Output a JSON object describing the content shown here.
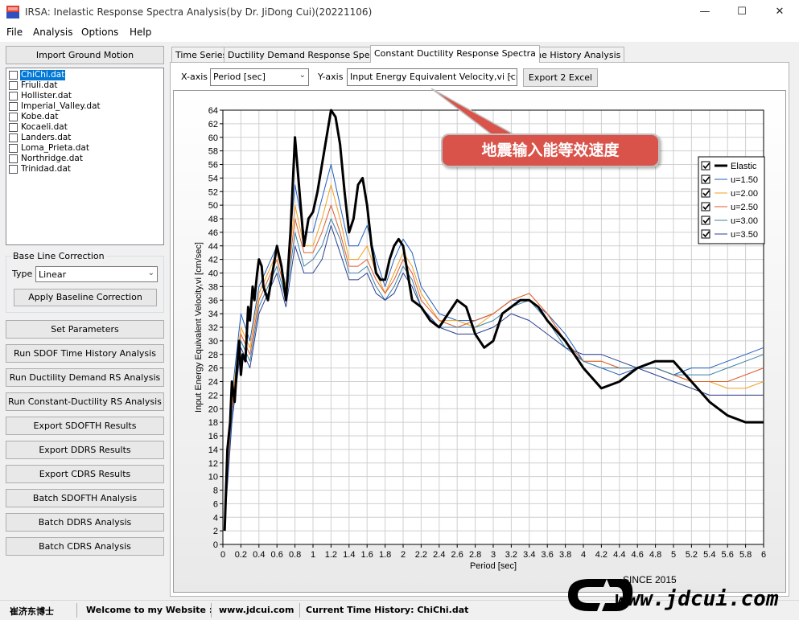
{
  "window": {
    "title": "IRSA: Inelastic Response Spectra Analysis(by Dr. JiDong Cui)(20221106)",
    "min_symbol": "—",
    "max_symbol": "☐",
    "close_symbol": "✕"
  },
  "menu": [
    "File",
    "Analysis",
    "Options",
    "Help"
  ],
  "left_panel": {
    "import_button": "Import Ground Motion",
    "files": [
      {
        "name": "ChiChi.dat",
        "selected": true
      },
      {
        "name": "Friuli.dat",
        "selected": false
      },
      {
        "name": "Hollister.dat",
        "selected": false
      },
      {
        "name": "Imperial_Valley.dat",
        "selected": false
      },
      {
        "name": "Kobe.dat",
        "selected": false
      },
      {
        "name": "Kocaeli.dat",
        "selected": false
      },
      {
        "name": "Landers.dat",
        "selected": false
      },
      {
        "name": "Loma_Prieta.dat",
        "selected": false
      },
      {
        "name": "Northridge.dat",
        "selected": false
      },
      {
        "name": "Trinidad.dat",
        "selected": false
      }
    ],
    "baseline": {
      "group_title": "Base Line Correction",
      "type_label": "Type",
      "type_value": "Linear",
      "apply_button": "Apply Baseline Correction"
    },
    "action_buttons": [
      "Set Parameters",
      "Run SDOF Time History Analysis",
      "Run Ductility Demand RS Analysis",
      "Run Constant-Ductility RS Analysis",
      "Export SDOFTH Results",
      "Export DDRS Results",
      "Export CDRS Results",
      "Batch SDOFTH Analysis",
      "Batch DDRS Analysis",
      "Batch CDRS Analysis"
    ]
  },
  "tabs": [
    {
      "label": "Time Series",
      "active": false
    },
    {
      "label": "Ductility Demand Response Spectra",
      "active": false
    },
    {
      "label": "Constant Ductility Response Spectra",
      "active": true
    },
    {
      "label": "Time History Analysis",
      "active": false
    }
  ],
  "toolbar": {
    "xaxis_label": "X-axis",
    "xaxis_value": "Period [sec]",
    "yaxis_label": "Y-axis",
    "yaxis_value": "Input Energy Equivalent Velocity,vi [cm,",
    "export_button": "Export 2 Excel"
  },
  "annotation": "地震输入能等效速度",
  "status": {
    "author": "崔济东博士",
    "welcome": "Welcome to my Website :",
    "website": "www.jdcui.com",
    "current": "Current Time History: ChiChi.dat"
  },
  "logo": {
    "since": "SINCE 2015",
    "url": "www.jdcui.com"
  },
  "chart_data": {
    "type": "line",
    "xlabel": "Period [sec]",
    "ylabel": "Input Energy Equivalent Velocity,vi [cm/sec]",
    "xlim": [
      0,
      6
    ],
    "ylim": [
      0,
      64
    ],
    "xticks": [
      "0",
      "0.2",
      "0.4",
      "0.6",
      "0.8",
      "1",
      "1.2",
      "1.4",
      "1.6",
      "1.8",
      "2",
      "2.2",
      "2.4",
      "2.6",
      "2.8",
      "3",
      "3.2",
      "3.4",
      "3.6",
      "3.8",
      "4",
      "4.2",
      "4.4",
      "4.6",
      "4.8",
      "5",
      "5.2",
      "5.4",
      "5.6",
      "5.8",
      "6"
    ],
    "yticks": [
      "0",
      "2",
      "4",
      "6",
      "8",
      "10",
      "12",
      "14",
      "16",
      "18",
      "20",
      "22",
      "24",
      "26",
      "28",
      "30",
      "32",
      "34",
      "36",
      "38",
      "40",
      "42",
      "44",
      "46",
      "48",
      "50",
      "52",
      "54",
      "56",
      "58",
      "60",
      "62",
      "64"
    ],
    "grid": true,
    "legend_position": "top-right",
    "series": [
      {
        "name": "Elastic",
        "color": "#000000",
        "width": 3,
        "x": [
          0.02,
          0.05,
          0.08,
          0.1,
          0.13,
          0.15,
          0.18,
          0.2,
          0.22,
          0.25,
          0.28,
          0.3,
          0.33,
          0.35,
          0.38,
          0.4,
          0.43,
          0.45,
          0.5,
          0.55,
          0.6,
          0.65,
          0.7,
          0.75,
          0.8,
          0.85,
          0.9,
          0.95,
          1.0,
          1.05,
          1.1,
          1.15,
          1.2,
          1.25,
          1.3,
          1.35,
          1.4,
          1.45,
          1.5,
          1.55,
          1.6,
          1.65,
          1.7,
          1.75,
          1.8,
          1.85,
          1.9,
          1.95,
          2.0,
          2.05,
          2.1,
          2.2,
          2.3,
          2.4,
          2.5,
          2.6,
          2.7,
          2.8,
          2.9,
          3.0,
          3.1,
          3.2,
          3.3,
          3.4,
          3.5,
          3.6,
          3.8,
          4.0,
          4.2,
          4.4,
          4.6,
          4.8,
          4.9,
          5.0,
          5.2,
          5.4,
          5.6,
          5.8,
          6.0
        ],
        "y": [
          2,
          14,
          18,
          24,
          21,
          25,
          30,
          25,
          28,
          27,
          35,
          33,
          38,
          36,
          40,
          42,
          41,
          38,
          36,
          40,
          44,
          41,
          36,
          46,
          60,
          52,
          44,
          48,
          49,
          52,
          56,
          60,
          64,
          63,
          59,
          52,
          46,
          48,
          53,
          54,
          50,
          44,
          40,
          39,
          39,
          42,
          44,
          45,
          44,
          40,
          36,
          35,
          33,
          32,
          34,
          36,
          35,
          31,
          29,
          30,
          34,
          35,
          36,
          36,
          35,
          33,
          30,
          26,
          23,
          24,
          26,
          27,
          27,
          27,
          24,
          21,
          19,
          18,
          18
        ]
      },
      {
        "name": "u=1.50",
        "color": "#1f5fbf",
        "width": 1,
        "x": [
          0.02,
          0.1,
          0.2,
          0.3,
          0.4,
          0.5,
          0.6,
          0.7,
          0.8,
          0.9,
          1.0,
          1.1,
          1.2,
          1.3,
          1.4,
          1.5,
          1.6,
          1.7,
          1.8,
          1.9,
          2.0,
          2.1,
          2.2,
          2.4,
          2.6,
          2.8,
          3.0,
          3.2,
          3.4,
          3.6,
          3.8,
          4.0,
          4.2,
          4.4,
          4.6,
          4.8,
          5.0,
          5.2,
          5.4,
          5.6,
          5.8,
          6.0
        ],
        "y": [
          3,
          22,
          34,
          30,
          38,
          41,
          44,
          38,
          53,
          46,
          46,
          51,
          56,
          50,
          44,
          44,
          47,
          42,
          38,
          42,
          45,
          43,
          38,
          34,
          33,
          33,
          34,
          36,
          36,
          34,
          31,
          27,
          26,
          25,
          26,
          26,
          25,
          26,
          26,
          27,
          28,
          29
        ]
      },
      {
        "name": "u=2.00",
        "color": "#f0a020",
        "width": 1,
        "x": [
          0.02,
          0.1,
          0.2,
          0.3,
          0.4,
          0.5,
          0.6,
          0.7,
          0.8,
          0.9,
          1.0,
          1.1,
          1.2,
          1.3,
          1.4,
          1.5,
          1.6,
          1.7,
          1.8,
          1.9,
          2.0,
          2.1,
          2.2,
          2.4,
          2.6,
          2.8,
          3.0,
          3.2,
          3.4,
          3.6,
          3.8,
          4.0,
          4.2,
          4.4,
          4.6,
          4.8,
          5.0,
          5.2,
          5.4,
          5.6,
          5.8,
          6.0
        ],
        "y": [
          3,
          21,
          32,
          29,
          37,
          40,
          43,
          38,
          50,
          44,
          44,
          48,
          53,
          48,
          42,
          42,
          44,
          40,
          37,
          40,
          43,
          41,
          37,
          33,
          33,
          32,
          34,
          36,
          37,
          34,
          30,
          27,
          27,
          26,
          26,
          26,
          25,
          24,
          24,
          23,
          23,
          24
        ]
      },
      {
        "name": "u=2.50",
        "color": "#e05a2a",
        "width": 1,
        "x": [
          0.02,
          0.1,
          0.2,
          0.3,
          0.4,
          0.5,
          0.6,
          0.7,
          0.8,
          0.9,
          1.0,
          1.1,
          1.2,
          1.3,
          1.4,
          1.5,
          1.6,
          1.7,
          1.8,
          1.9,
          2.0,
          2.1,
          2.2,
          2.4,
          2.6,
          2.8,
          3.0,
          3.2,
          3.4,
          3.6,
          3.8,
          4.0,
          4.2,
          4.4,
          4.6,
          4.8,
          5.0,
          5.2,
          5.4,
          5.6,
          5.8,
          6.0
        ],
        "y": [
          3,
          20,
          31,
          28,
          36,
          39,
          42,
          37,
          48,
          43,
          43,
          46,
          50,
          46,
          41,
          41,
          42,
          39,
          37,
          39,
          42,
          40,
          36,
          33,
          32,
          33,
          34,
          36,
          37,
          34,
          30,
          27,
          27,
          26,
          26,
          26,
          25,
          24,
          24,
          24,
          25,
          26
        ]
      },
      {
        "name": "u=3.00",
        "color": "#3a7fa8",
        "width": 1,
        "x": [
          0.02,
          0.1,
          0.2,
          0.3,
          0.4,
          0.5,
          0.6,
          0.7,
          0.8,
          0.9,
          1.0,
          1.1,
          1.2,
          1.3,
          1.4,
          1.5,
          1.6,
          1.7,
          1.8,
          1.9,
          2.0,
          2.1,
          2.2,
          2.4,
          2.6,
          2.8,
          3.0,
          3.2,
          3.4,
          3.6,
          3.8,
          4.0,
          4.2,
          4.4,
          4.6,
          4.8,
          5.0,
          5.2,
          5.4,
          5.6,
          5.8,
          6.0
        ],
        "y": [
          3,
          19,
          30,
          27,
          35,
          38,
          41,
          36,
          46,
          41,
          42,
          44,
          48,
          45,
          40,
          40,
          41,
          38,
          36,
          38,
          41,
          39,
          35,
          32,
          32,
          32,
          33,
          35,
          36,
          33,
          29,
          27,
          26,
          26,
          26,
          26,
          25,
          25,
          25,
          26,
          27,
          28
        ]
      },
      {
        "name": "u=3.50",
        "color": "#2a3f8f",
        "width": 1,
        "x": [
          0.02,
          0.1,
          0.2,
          0.3,
          0.4,
          0.5,
          0.6,
          0.7,
          0.8,
          0.9,
          1.0,
          1.1,
          1.2,
          1.3,
          1.4,
          1.5,
          1.6,
          1.7,
          1.8,
          1.9,
          2.0,
          2.1,
          2.2,
          2.4,
          2.6,
          2.8,
          3.0,
          3.2,
          3.4,
          3.6,
          3.8,
          4.0,
          4.2,
          4.4,
          4.6,
          4.8,
          5.0,
          5.2,
          5.4,
          5.6,
          5.8,
          6.0
        ],
        "y": [
          3,
          18,
          29,
          26,
          34,
          37,
          40,
          35,
          44,
          40,
          40,
          42,
          47,
          43,
          39,
          39,
          40,
          37,
          36,
          37,
          40,
          38,
          35,
          32,
          31,
          31,
          32,
          34,
          33,
          31,
          29,
          28,
          28,
          27,
          26,
          25,
          24,
          23,
          22,
          22,
          22,
          22
        ]
      }
    ]
  }
}
